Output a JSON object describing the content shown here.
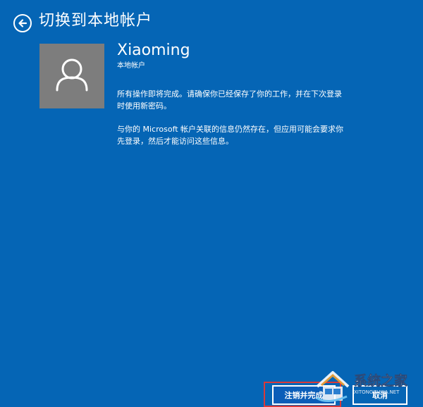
{
  "header": {
    "title": "切换到本地帐户",
    "back_icon": "back-arrow-icon"
  },
  "account": {
    "avatar_icon": "user-icon",
    "name": "Xiaoming",
    "type_label": "本地帐户"
  },
  "messages": {
    "paragraph1_line1": "所有操作即将完成。请确保你已经保存了你的工作，并在下次登录",
    "paragraph1_line2": "时使用新密码。",
    "paragraph2_line1": "与你的 Microsoft 帐户关联的信息仍然存在，但应用可能会要求你",
    "paragraph2_line2": "先登录，然后才能访问这些信息。"
  },
  "buttons": {
    "sign_out_finish": "注销并完成",
    "cancel": "取消"
  },
  "watermark": {
    "brand": "系统之家",
    "url": "XITONGZHIJIA.NET"
  },
  "colors": {
    "background": "#0565b5",
    "avatar_bg": "#7d7d7d",
    "highlight_outline": "#d93a3a",
    "text": "#ffffff"
  }
}
